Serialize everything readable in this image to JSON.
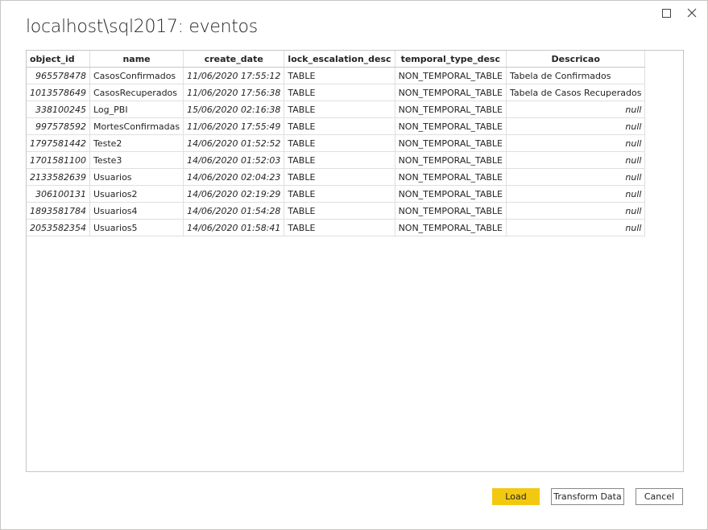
{
  "window": {
    "title": "localhost\\sql2017: eventos"
  },
  "icons": {
    "maximize": "maximize-icon",
    "close": "close-icon"
  },
  "table": {
    "columns": [
      "object_id",
      "name",
      "create_date",
      "lock_escalation_desc",
      "temporal_type_desc",
      "Descricao"
    ],
    "rows": [
      [
        "965578478",
        "CasosConfirmados",
        "11/06/2020 17:55:12",
        "TABLE",
        "NON_TEMPORAL_TABLE",
        "Tabela de Confirmados"
      ],
      [
        "1013578649",
        "CasosRecuperados",
        "11/06/2020 17:56:38",
        "TABLE",
        "NON_TEMPORAL_TABLE",
        "Tabela de Casos Recuperados"
      ],
      [
        "338100245",
        "Log_PBI",
        "15/06/2020 02:16:38",
        "TABLE",
        "NON_TEMPORAL_TABLE",
        "null"
      ],
      [
        "997578592",
        "MortesConfirmadas",
        "11/06/2020 17:55:49",
        "TABLE",
        "NON_TEMPORAL_TABLE",
        "null"
      ],
      [
        "1797581442",
        "Teste2",
        "14/06/2020 01:52:52",
        "TABLE",
        "NON_TEMPORAL_TABLE",
        "null"
      ],
      [
        "1701581100",
        "Teste3",
        "14/06/2020 01:52:03",
        "TABLE",
        "NON_TEMPORAL_TABLE",
        "null"
      ],
      [
        "2133582639",
        "Usuarios",
        "14/06/2020 02:04:23",
        "TABLE",
        "NON_TEMPORAL_TABLE",
        "null"
      ],
      [
        "306100131",
        "Usuarios2",
        "14/06/2020 02:19:29",
        "TABLE",
        "NON_TEMPORAL_TABLE",
        "null"
      ],
      [
        "1893581784",
        "Usuarios4",
        "14/06/2020 01:54:28",
        "TABLE",
        "NON_TEMPORAL_TABLE",
        "null"
      ],
      [
        "2053582354",
        "Usuarios5",
        "14/06/2020 01:58:41",
        "TABLE",
        "NON_TEMPORAL_TABLE",
        "null"
      ]
    ]
  },
  "buttons": {
    "load": "Load",
    "transform": "Transform Data",
    "cancel": "Cancel"
  },
  "colors": {
    "accent": "#f2c811"
  }
}
